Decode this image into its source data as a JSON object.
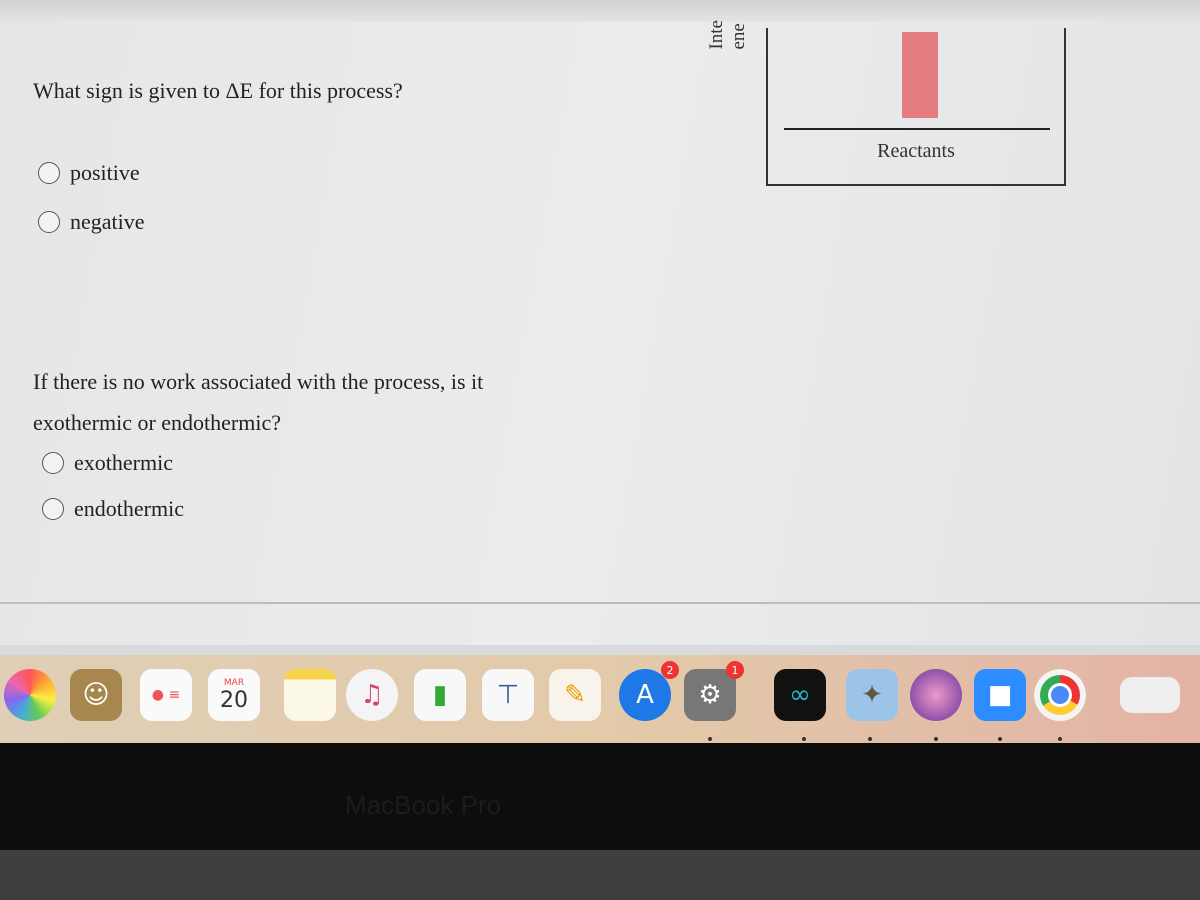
{
  "question1": {
    "text": "What sign is given to ΔE for this process?",
    "options": [
      "positive",
      "negative"
    ]
  },
  "question2": {
    "line1": "If there is no work associated with the process, is it",
    "line2": "exothermic or endothermic?",
    "options": [
      "exothermic",
      "endothermic"
    ]
  },
  "diagram": {
    "axis_label_fragment_1": "Inte",
    "axis_label_fragment_2": "ene",
    "reactants_label": "Reactants",
    "bar_color": "#e57c80"
  },
  "dock": {
    "calendar_month": "MAR",
    "calendar_day": "20",
    "app_store_badge": "2",
    "settings_badge": "1",
    "icons": [
      "photos-icon",
      "contacts-icon",
      "reminders-icon",
      "calendar-icon",
      "notes-icon",
      "music-icon",
      "numbers-icon",
      "keynote-icon",
      "pages-icon",
      "app-store-icon",
      "system-preferences-icon",
      "webex-icon",
      "preview-icon",
      "monterey-installer-icon",
      "zoom-icon",
      "chrome-icon",
      "downloads-stack-icon"
    ]
  },
  "bezel": {
    "label": "MacBook Pro"
  }
}
